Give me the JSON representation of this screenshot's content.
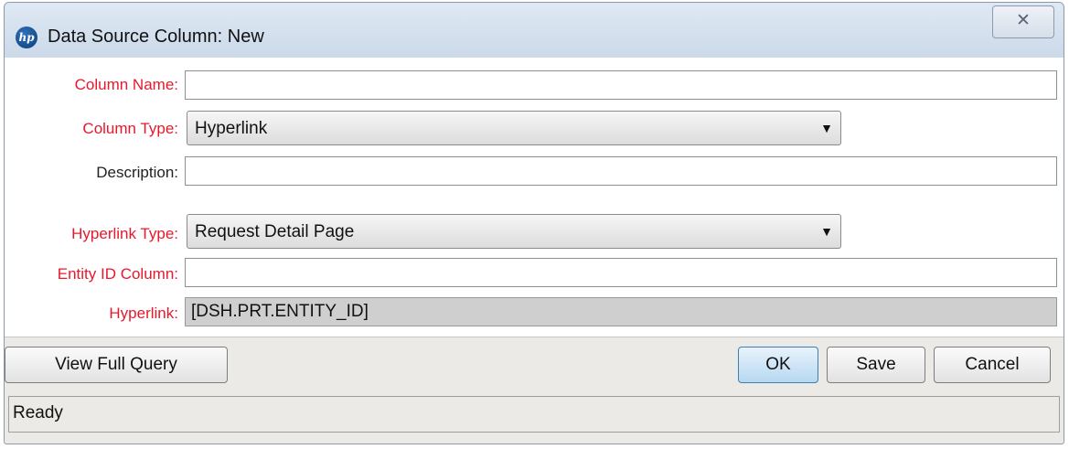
{
  "window": {
    "title": "Data Source Column: New",
    "logo_text": "hp",
    "close_glyph": "✕"
  },
  "form": {
    "column_name": {
      "label": "Column Name:",
      "value": "",
      "required": true
    },
    "column_type": {
      "label": "Column Type:",
      "selected": "Hyperlink",
      "required": true
    },
    "description": {
      "label": "Description:",
      "value": "",
      "required": false
    },
    "hyperlink_type": {
      "label": "Hyperlink Type:",
      "selected": "Request Detail Page",
      "required": true
    },
    "entity_id_column": {
      "label": "Entity ID Column:",
      "value": "",
      "required": true
    },
    "hyperlink": {
      "label": "Hyperlink:",
      "value": "[DSH.PRT.ENTITY_ID]",
      "required": true,
      "readonly": true
    }
  },
  "buttons": {
    "view_full_query": "View Full Query",
    "ok": "OK",
    "save": "Save",
    "cancel": "Cancel"
  },
  "status": {
    "text": "Ready"
  },
  "colors": {
    "required_label": "#e8182b",
    "window_bg": "#eceae6",
    "titlebar": "#dfe9f4",
    "default_button": "#b7d8f1",
    "readonly_field": "#cfcfcf"
  },
  "icons": {
    "combo_arrow": "▼"
  }
}
